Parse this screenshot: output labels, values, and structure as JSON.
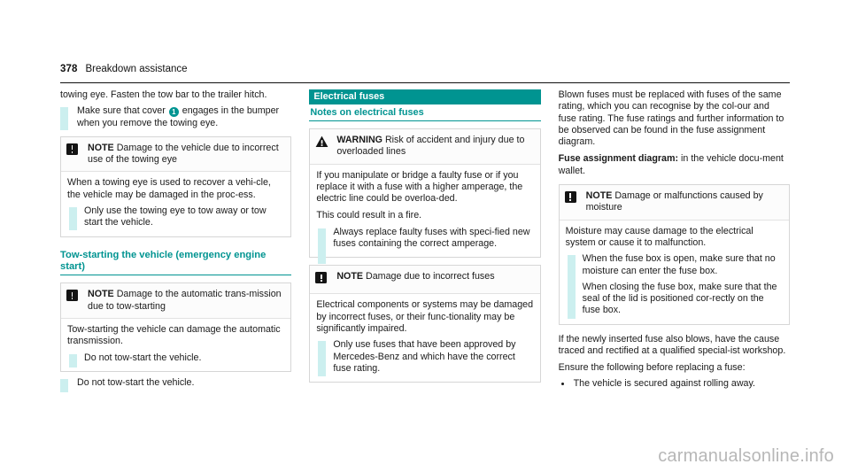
{
  "header": {
    "page_number": "378",
    "chapter": "Breakdown assistance"
  },
  "left_column": {
    "intro_paragraph": "towing eye. Fasten the tow bar to the trailer hitch.",
    "step_1": "Make sure that cover",
    "step_1_ref": "1",
    "step_1_cont": "engages in the bumper when you remove the towing eye.",
    "note_1": {
      "icon": "note-icon",
      "label": "NOTE",
      "title": "Damage to the vehicle due to incorrect use of the towing eye",
      "body": "When a towing eye is used to recover a vehi-cle, the vehicle may be damaged in the proc-ess.",
      "step": "Only use the towing eye to tow away or tow start the vehicle."
    },
    "section_title": "Tow-starting the vehicle (emergency engine start)",
    "note_2": {
      "icon": "note-icon",
      "label": "NOTE",
      "title": "Damage to the automatic trans-mission due to tow-starting",
      "body": "Tow-starting the vehicle can damage the automatic transmission.",
      "step": "Do not tow-start the vehicle."
    },
    "final_step": "Do not tow-start the vehicle."
  },
  "mid_column": {
    "band_title": "Electrical fuses",
    "sub_title": "Notes on electrical fuses",
    "warning": {
      "icon": "warning-triangle-icon",
      "label": "WARNING",
      "title": "Risk of accident and injury due to overloaded lines",
      "body_1": "If you manipulate or bridge a faulty fuse or if you replace it with a fuse with a higher amperage, the electric line could be overloa-ded.",
      "body_2": "This could result in a fire.",
      "step": "Always replace faulty fuses with speci-fied new fuses containing the correct amperage."
    },
    "note": {
      "icon": "note-icon",
      "label": "NOTE",
      "title": "Damage due to incorrect fuses",
      "body": "Electrical components or systems may be damaged by incorrect fuses, or their func-tionality may be significantly impaired.",
      "step": "Only use fuses that have been approved by Mercedes-Benz and which have the correct fuse rating."
    }
  },
  "right_column": {
    "paragraph_1": "Blown fuses must be replaced with fuses of the same rating, which you can recognise by the col-our and fuse rating. The fuse ratings and further information to be observed can be found in the fuse assignment diagram.",
    "fuse_diagram_label": "Fuse assignment diagram:",
    "fuse_diagram_text": " in the vehicle docu-ment wallet.",
    "note": {
      "icon": "note-icon",
      "label": "NOTE",
      "title": "Damage or malfunctions caused by moisture",
      "body": "Moisture may cause damage to the electrical system or cause it to malfunction.",
      "step_1": "When the fuse box is open, make sure that no moisture can enter the fuse box.",
      "step_2": "When closing the fuse box, make sure that the seal of the lid is positioned cor-rectly on the fuse box."
    },
    "paragraph_2": "If the newly inserted fuse also blows, have the cause traced and rectified at a qualified special-ist workshop.",
    "paragraph_3": "Ensure the following before replacing a fuse:",
    "bullets": [
      "The vehicle is secured against rolling away."
    ]
  },
  "watermark": "carmanualsonline.info",
  "colors": {
    "teal": "#009491",
    "teal_light": "#ccefef",
    "text": "#1a1a1a",
    "watermark": "#b7b7b7"
  }
}
